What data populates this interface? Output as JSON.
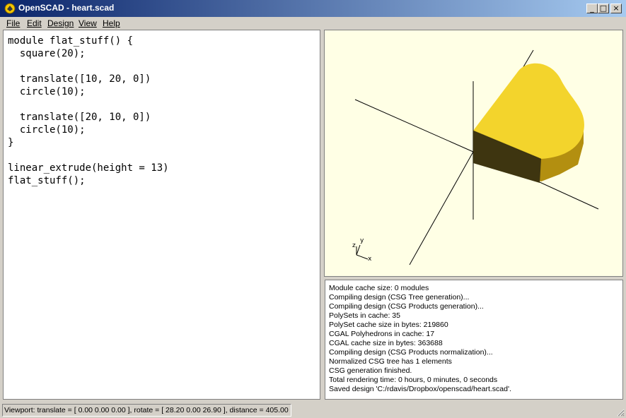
{
  "window": {
    "title": "OpenSCAD - heart.scad",
    "controls": {
      "minimize": "_",
      "maximize": "□",
      "close": "×"
    }
  },
  "menu": [
    {
      "label": "File"
    },
    {
      "label": "Edit"
    },
    {
      "label": "Design"
    },
    {
      "label": "View"
    },
    {
      "label": "Help"
    }
  ],
  "editor": {
    "code": "module flat_stuff() {\n  square(20);\n\n  translate([10, 20, 0])\n  circle(10);\n\n  translate([20, 10, 0])\n  circle(10);\n}\n\nlinear_extrude(height = 13)\nflat_stuff();"
  },
  "viewport": {
    "axes_labels": {
      "x": "x",
      "y": "y",
      "z": "z"
    },
    "model_color": "#f3d42c",
    "background_color": "#ffffe5"
  },
  "console": {
    "lines": [
      "Module cache size: 0 modules",
      "Compiling design (CSG Tree generation)...",
      "Compiling design (CSG Products generation)...",
      "PolySets in cache: 35",
      "PolySet cache size in bytes: 219860",
      "CGAL Polyhedrons in cache: 17",
      "CGAL cache size in bytes: 363688",
      "Compiling design (CSG Products normalization)...",
      "Normalized CSG tree has 1 elements",
      "CSG generation finished.",
      "Total rendering time: 0 hours, 0 minutes, 0 seconds",
      "Saved design 'C:/rdavis/Dropbox/openscad/heart.scad'."
    ]
  },
  "statusbar": {
    "text": "Viewport: translate = [ 0.00 0.00 0.00 ], rotate = [ 28.20 0.00 26.90 ], distance = 405.00"
  }
}
